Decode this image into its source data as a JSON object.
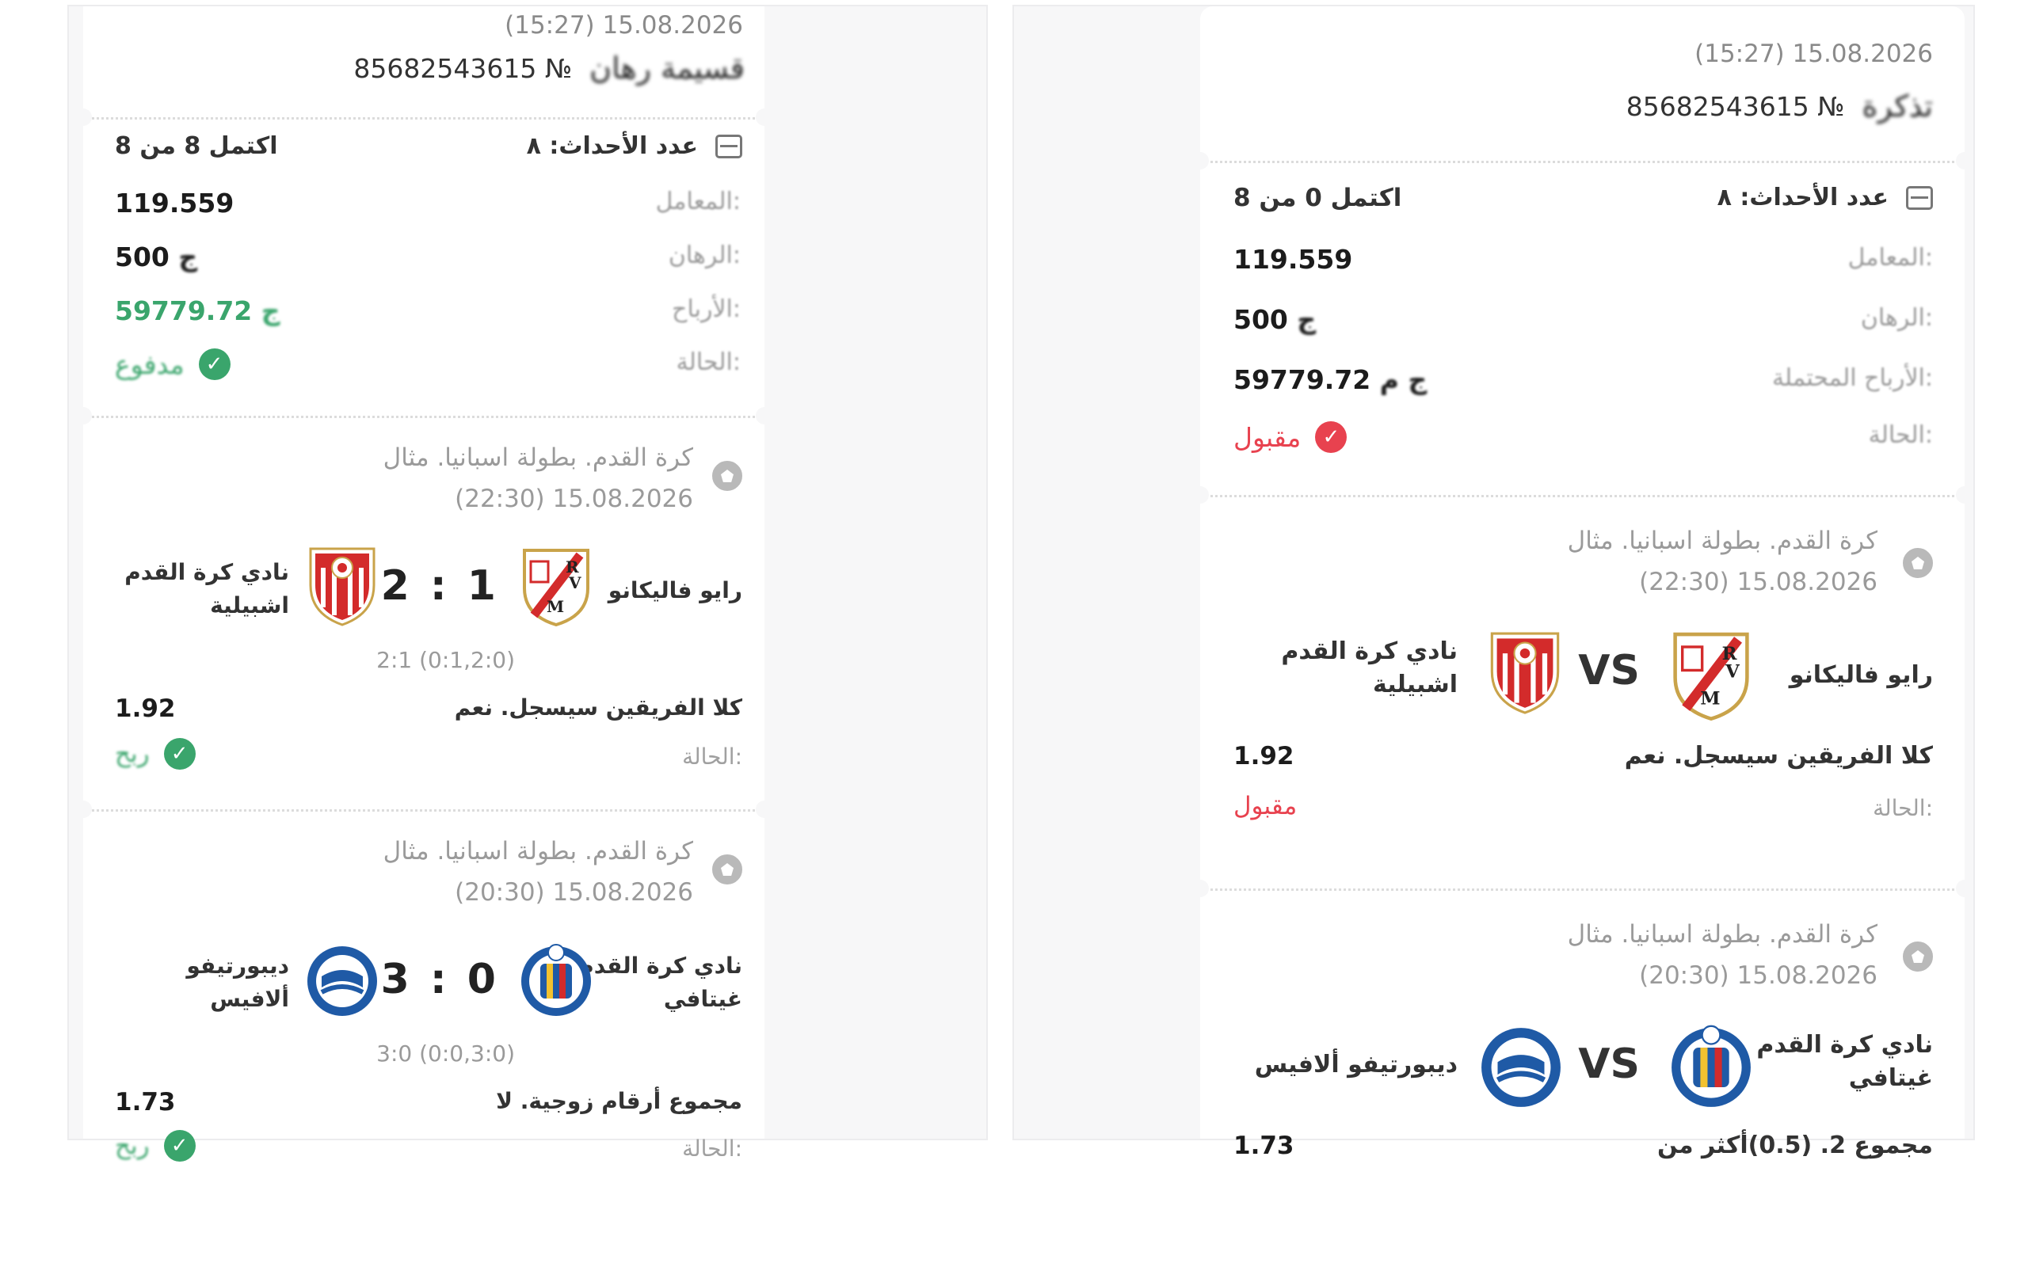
{
  "left": {
    "datetime": "(15:27) 15.08.2026",
    "ticket_no": "85682543615 №",
    "ticket_label": "قسيمة رهان",
    "events_label": "عدد الأحداث: ٨",
    "completed": "اكتمل 8 من 8",
    "coef_label": "المعامل:",
    "coef_value": "119.559",
    "stake_label": "الرهان:",
    "stake_value": "500",
    "stake_suffix": "ج",
    "winnings_label": "الأرباح:",
    "winnings_value": "59779.72",
    "winnings_suffix": "ج",
    "status_label": "الحالة:",
    "status_value": "مدفوع",
    "events": [
      {
        "league": "كرة القدم. بطولة اسبانيا. مثال",
        "datetime": "(22:30) 15.08.2026",
        "home": "رايو فاليكانو",
        "away_line1": "نادي كرة القدم",
        "away_line2": "اشبيلية",
        "score": "2 : 1",
        "breakdown": "2:1 (0:1,2:0)",
        "market": "كلا الفريقين سيسجل. نعم",
        "odds": "1.92",
        "state_label": "الحالة:",
        "state": "ربح"
      },
      {
        "league": "كرة القدم. بطولة اسبانيا. مثال",
        "datetime": "(20:30) 15.08.2026",
        "home_line1": "نادي كرة القدم",
        "home_line2": "غيتافي",
        "away_line1": "ديبورتيفو",
        "away_line2": "ألافيس",
        "score": "3 : 0",
        "breakdown": "3:0 (0:0,3:0)",
        "market": "مجموع أرقام زوجية. لا",
        "odds": "1.73",
        "state_label": "الحالة:",
        "state": "ربح"
      }
    ]
  },
  "right": {
    "datetime": "(15:27) 15.08.2026",
    "ticket_no": "85682543615 №",
    "ticket_label": "تذكرة",
    "events_label": "عدد الأحداث: ٨",
    "completed": "اكتمل 0 من 8",
    "coef_label": "المعامل:",
    "coef_value": "119.559",
    "stake_label": "الرهان:",
    "stake_value": "500",
    "stake_suffix": "ج",
    "winnings_label": "الأرباح المحتملة:",
    "winnings_value": "59779.72",
    "winnings_suffix": "ج م",
    "status_label": "الحالة:",
    "status_value": "مقبول",
    "events": [
      {
        "league": "كرة القدم. بطولة اسبانيا. مثال",
        "datetime": "(22:30) 15.08.2026",
        "home": "رايو فاليكانو",
        "away_line1": "نادي كرة القدم",
        "away_line2": "اشبيلية",
        "vs": "VS",
        "market": "كلا الفريقين سيسجل. نعم",
        "odds": "1.92",
        "state_label": "الحالة:",
        "state": "مقبول"
      },
      {
        "league": "كرة القدم. بطولة اسبانيا. مثال",
        "datetime": "(20:30) 15.08.2026",
        "home_line1": "نادي كرة القدم",
        "home_line2": "غيتافي",
        "away": "ديبورتيفو ألافيس",
        "vs": "VS",
        "market": "مجموع 2. (0.5)أكثر من",
        "odds": "1.73"
      }
    ]
  },
  "colors": {
    "win_green": "#3aa56c",
    "accepted_red": "#e8424f",
    "muted": "#9a9a9a"
  },
  "icons": [
    "events-list-icon",
    "soccer-ball-icon",
    "check-circle-icon",
    "rayo-vallecano-crest-icon",
    "sevilla-crest-icon",
    "getafe-crest-icon",
    "alaves-crest-icon"
  ]
}
